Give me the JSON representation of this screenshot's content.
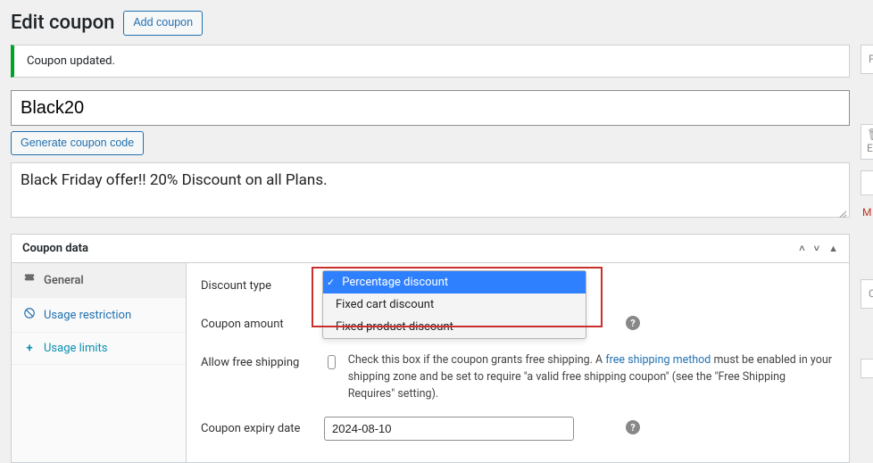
{
  "header": {
    "title": "Edit coupon",
    "add_button": "Add coupon"
  },
  "notice": {
    "message": "Coupon updated."
  },
  "coupon": {
    "code": "Black20",
    "generate_button": "Generate coupon code",
    "description": "Black Friday offer!! 20% Discount on all Plans."
  },
  "metabox": {
    "title": "Coupon data",
    "tabs": {
      "general": "General",
      "restriction": "Usage restriction",
      "limits": "Usage limits"
    },
    "fields": {
      "discount_type": {
        "label": "Discount type",
        "options": [
          "Percentage discount",
          "Fixed cart discount",
          "Fixed product discount"
        ],
        "selected": "Percentage discount"
      },
      "coupon_amount": {
        "label": "Coupon amount",
        "value": ""
      },
      "free_shipping": {
        "label": "Allow free shipping",
        "text_pre": "Check this box if the coupon grants free shipping. A ",
        "link_text": "free shipping method",
        "text_post": " must be enabled in your shipping zone and be set to require \"a valid free shipping coupon\" (see the \"Free Shipping Requires\" setting)."
      },
      "expiry": {
        "label": "Coupon expiry date",
        "value": "2024-08-10"
      }
    }
  },
  "side": {
    "p_label": "P",
    "e_label": "E",
    "m_label": "M",
    "c_label": "C"
  }
}
